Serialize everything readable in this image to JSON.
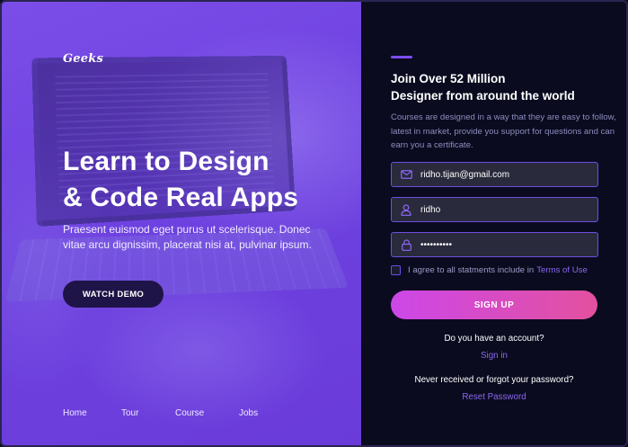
{
  "hero": {
    "logo": "Geeks",
    "title_line1": "Learn to Design",
    "title_line2": "& Code Real Apps",
    "subtitle": "Praesent euismod eget purus ut scelerisque. Donec vitae arcu dignissim, placerat nisi at, pulvinar ipsum.",
    "cta_label": "WATCH DEMO",
    "nav": [
      {
        "label": "Home"
      },
      {
        "label": "Tour"
      },
      {
        "label": "Course"
      },
      {
        "label": "Jobs"
      }
    ]
  },
  "form": {
    "title_line1": "Join Over 52 Million",
    "title_line2": "Designer from around the world",
    "description": "Courses are designed in a way that they are easy to follow, latest in market, provide you support for questions and can earn you a certificate.",
    "email": {
      "value": "ridho.tijan@gmail.com",
      "icon": "mail-icon"
    },
    "username": {
      "value": "ridho",
      "icon": "user-icon"
    },
    "password": {
      "value": "••••••••••",
      "icon": "lock-icon"
    },
    "agree_text": "I agree to all statments include in",
    "terms_label": "Terms of Use",
    "signup_label": "SIGN UP",
    "have_account": "Do you have an account?",
    "signin_label": "Sign in",
    "forgot_text": "Never received or forgot your password?",
    "reset_label": "Reset Password"
  },
  "colors": {
    "accent": "#7b4dee",
    "hero_bg": "#6e42e0",
    "panel_bg": "#0a0b1f",
    "button_gradient_start": "#cc47e8",
    "button_gradient_end": "#e3519f",
    "link": "#8a68f2"
  }
}
